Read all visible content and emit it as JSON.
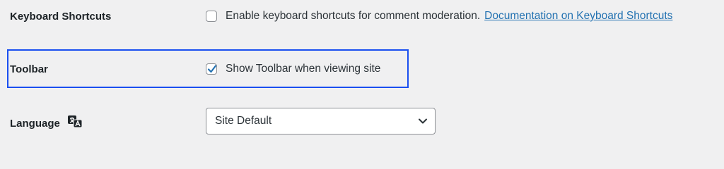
{
  "keyboard_shortcuts": {
    "label": "Keyboard Shortcuts",
    "checkbox_text": "Enable keyboard shortcuts for comment moderation.",
    "checked": false,
    "link_text": "Documentation on Keyboard Shortcuts"
  },
  "toolbar": {
    "label": "Toolbar",
    "checkbox_text": "Show Toolbar when viewing site",
    "checked": true,
    "focus_color": "#1a4ff0"
  },
  "language": {
    "label": "Language",
    "icon": "translation-icon",
    "selected_value": "Site Default"
  },
  "colors": {
    "background": "#f0f0f1",
    "link": "#2271b1",
    "checkmark": "#2271b1"
  }
}
